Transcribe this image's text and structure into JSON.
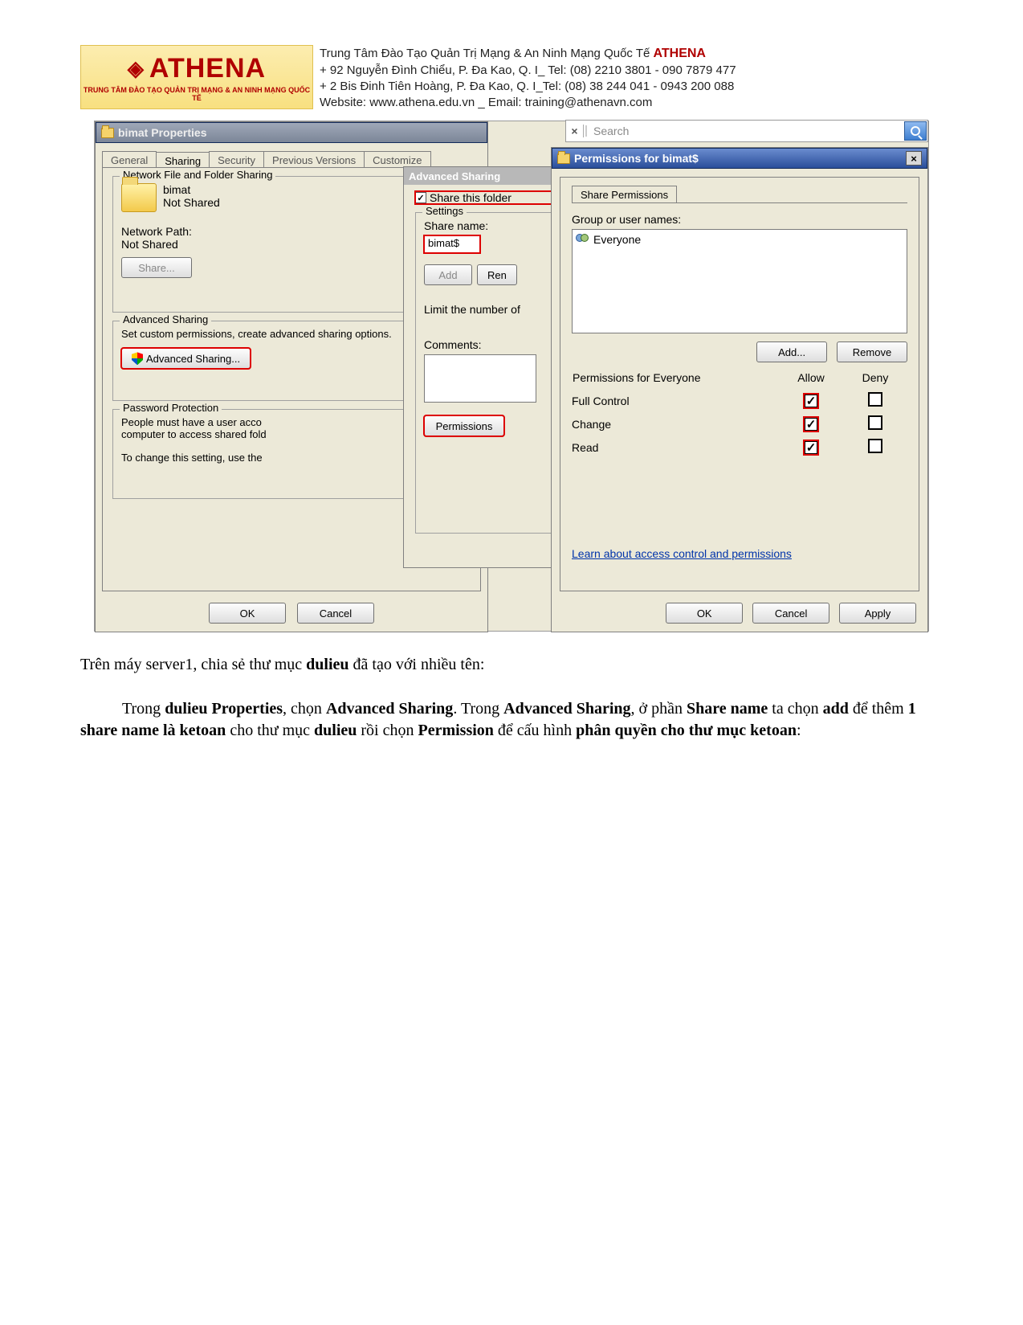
{
  "header": {
    "logo_big": "ATHENA",
    "logo_small": "TRUNG TÂM ĐÀO TẠO QUẢN TRỊ MẠNG & AN NINH MẠNG QUỐC TẾ",
    "line1_a": "Trung Tâm Đào Tạo Quản Trị Mạng & An Ninh Mạng Quốc Tế ",
    "line1_b": "ATHENA",
    "line2": "+  92 Nguyễn Đình Chiểu, P. Đa Kao, Q. I_ Tel: (08) 2210 3801 -  090 7879 477",
    "line3": "+  2 Bis Đinh Tiên Hoàng, P. Đa Kao, Q. I_Tel: (08) 38 244 041 - 0943 200 088",
    "line4": "Website: www.athena.edu.vn     _       Email: training@athenavn.com"
  },
  "search": {
    "x": "×",
    "placeholder": "Search"
  },
  "props": {
    "title": "bimat Properties",
    "tabs": [
      "General",
      "Sharing",
      "Security",
      "Previous Versions",
      "Customize"
    ],
    "active_tab": 1,
    "nw_fieldset": "Network File and Folder Sharing",
    "folder_name": "bimat",
    "not_shared": "Not Shared",
    "nw_path_lbl": "Network Path:",
    "nw_path_val": "Not Shared",
    "share_btn": "Share...",
    "adv_fieldset": "Advanced Sharing",
    "adv_text": "Set custom permissions, create advanced sharing options.",
    "adv_btn": "Advanced Sharing...",
    "pw_fieldset": "Password Protection",
    "pw_text1": "People must have a user acco",
    "pw_text2": "computer to access shared fold",
    "pw_text3": "To change this setting, use the",
    "ok": "OK",
    "cancel": "Cancel"
  },
  "adv": {
    "title": "Advanced Sharing",
    "share_this": "Share this folder",
    "settings": "Settings",
    "share_name_lbl": "Share name:",
    "share_name_val": "bimat$",
    "add": "Add",
    "remove": "Ren",
    "limit": "Limit the number of",
    "comments": "Comments:",
    "permissions": "Permissions"
  },
  "perm": {
    "title": "Permissions for bimat$",
    "close": "×",
    "tab": "Share Permissions",
    "group_lbl": "Group or user names:",
    "user": "Everyone",
    "add": "Add...",
    "remove": "Remove",
    "perm_for": "Permissions for Everyone",
    "allow": "Allow",
    "deny": "Deny",
    "rows": [
      {
        "name": "Full Control",
        "allow": true,
        "deny": false
      },
      {
        "name": "Change",
        "allow": true,
        "deny": false
      },
      {
        "name": "Read",
        "allow": true,
        "deny": false
      }
    ],
    "link": "Learn about access control and permissions",
    "ok": "OK",
    "cancel": "Cancel",
    "apply": "Apply"
  },
  "body": {
    "p1_a": "Trên máy server1, chia sẻ thư mục ",
    "p1_b": "dulieu",
    "p1_c": " đã tạo với nhiều tên:",
    "p2_a": "Trong ",
    "p2_b": "dulieu Properties",
    "p2_c": ", chọn ",
    "p2_d": "Advanced Sharing",
    "p2_e": ". Trong ",
    "p2_f": "Advanced Sharing",
    "p2_g": ", ở phần ",
    "p2_h": "Share name",
    "p2_i": " ta chọn ",
    "p2_j": "add",
    "p2_k": " để thêm ",
    "p2_l": "1 share name là ketoan",
    "p2_m": " cho thư mục ",
    "p2_n": "dulieu",
    "p2_o": " rồi chọn ",
    "p2_p": "Permission",
    "p2_q": " để cấu hình ",
    "p2_r": "phân quyền cho thư mục ketoan",
    "p2_s": ":"
  }
}
